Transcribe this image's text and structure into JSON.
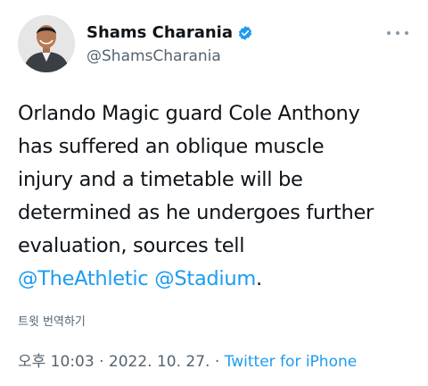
{
  "author": {
    "name": "Shams Charania",
    "handle": "@ShamsCharania",
    "verified": true
  },
  "tweet": {
    "lines": [
      "Orlando Magic guard Cole Anthony",
      "has suffered an oblique muscle",
      "injury and a timetable will be",
      "determined as he undergoes further",
      "evaluation, sources tell"
    ],
    "mention_1": "@TheAthletic",
    "mention_2": "@Stadium",
    "end_punct": "."
  },
  "translate_label": "트윗 번역하기",
  "meta": {
    "time": "오후 10:03",
    "sep1": " · ",
    "date": "2022. 10. 27.",
    "sep2": " · ",
    "source": "Twitter for iPhone"
  },
  "colors": {
    "link": "#1d9bf0",
    "secondary_text": "#536471",
    "primary_text": "#0f1419"
  }
}
